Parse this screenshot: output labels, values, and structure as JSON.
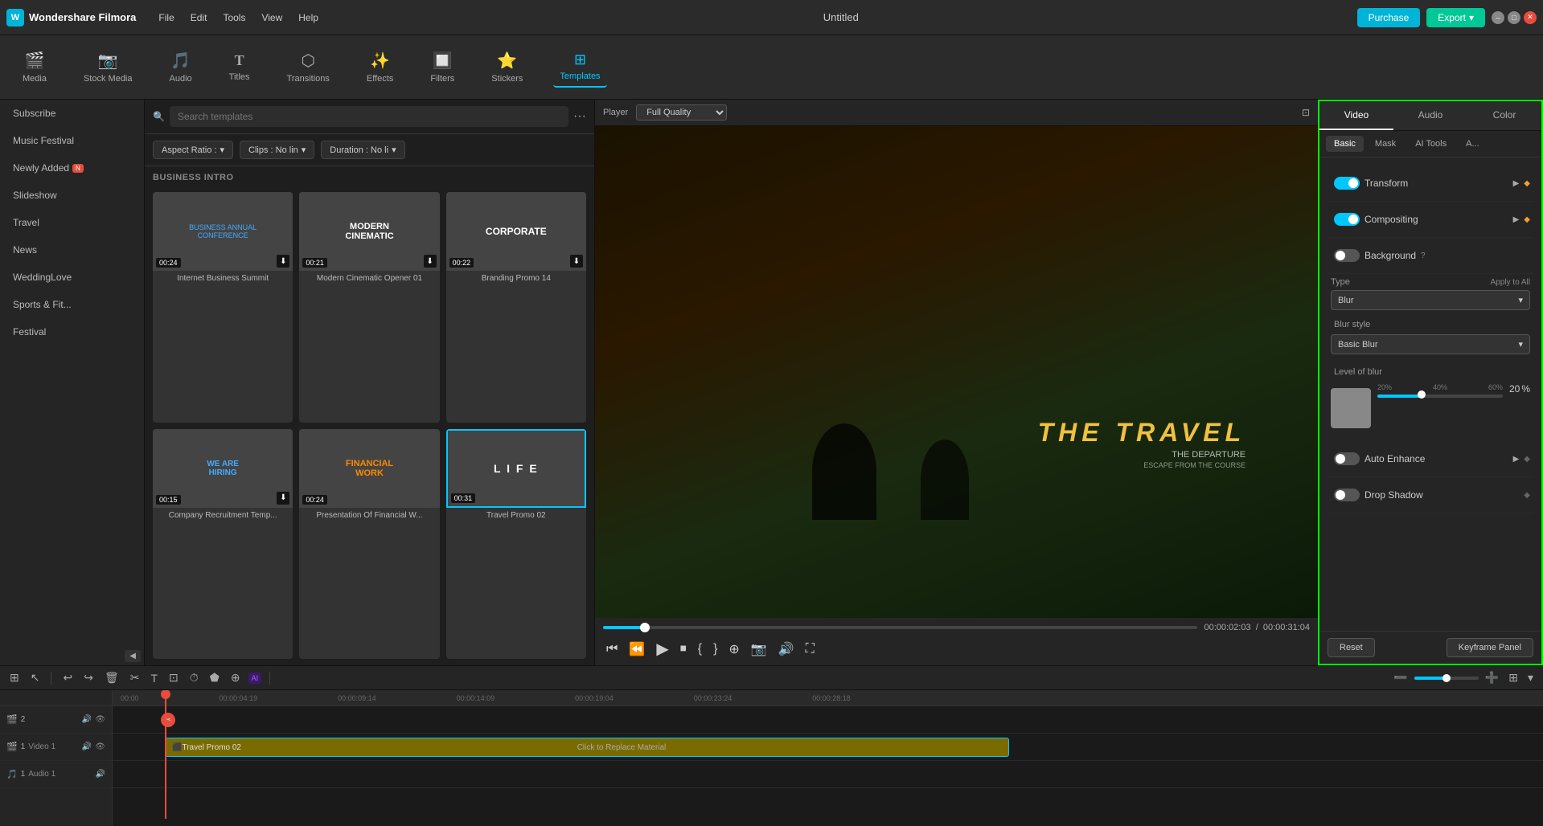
{
  "app": {
    "name": "Wondershare Filmora",
    "title": "Untitled"
  },
  "topbar": {
    "menu": [
      "File",
      "Edit",
      "Tools",
      "View",
      "Help"
    ],
    "purchase_label": "Purchase",
    "export_label": "Export"
  },
  "toolbar": {
    "items": [
      {
        "id": "media",
        "label": "Media",
        "icon": "🎬"
      },
      {
        "id": "stock",
        "label": "Stock Media",
        "icon": "📷"
      },
      {
        "id": "audio",
        "label": "Audio",
        "icon": "🎵"
      },
      {
        "id": "titles",
        "label": "Titles",
        "icon": "T"
      },
      {
        "id": "transitions",
        "label": "Transitions",
        "icon": "⬡"
      },
      {
        "id": "effects",
        "label": "Effects",
        "icon": "✨"
      },
      {
        "id": "filters",
        "label": "Filters",
        "icon": "🔲"
      },
      {
        "id": "stickers",
        "label": "Stickers",
        "icon": "⭐"
      },
      {
        "id": "templates",
        "label": "Templates",
        "icon": "⊞"
      }
    ]
  },
  "sidebar": {
    "items": [
      {
        "id": "subscribe",
        "label": "Subscribe"
      },
      {
        "id": "music-festival",
        "label": "Music Festival"
      },
      {
        "id": "newly-added",
        "label": "Newly Added",
        "badge": true
      },
      {
        "id": "slideshow",
        "label": "Slideshow"
      },
      {
        "id": "travel",
        "label": "Travel"
      },
      {
        "id": "news",
        "label": "News"
      },
      {
        "id": "weddinglove",
        "label": "WeddingLove"
      },
      {
        "id": "sports",
        "label": "Sports & Fit..."
      },
      {
        "id": "festival",
        "label": "Festival"
      }
    ]
  },
  "templates_panel": {
    "search_placeholder": "Search templates",
    "section_label": "BUSINESS INTRO",
    "filters": {
      "aspect_ratio": "Aspect Ratio :",
      "clips_no": "Clips : No lin",
      "duration": "Duration : No li"
    },
    "cards": [
      {
        "id": 1,
        "title": "Internet Business Summit",
        "duration": "00:24",
        "color": "business",
        "has_download": true
      },
      {
        "id": 2,
        "title": "Modern Cinematic Opener 01",
        "duration": "00:21",
        "color": "cinematic",
        "has_download": true
      },
      {
        "id": 3,
        "title": "Branding Promo 14",
        "duration": "00:22",
        "color": "corporate",
        "has_download": true
      },
      {
        "id": 4,
        "title": "Company Recruitment Temp...",
        "duration": "00:15",
        "color": "recruitment",
        "has_download": true
      },
      {
        "id": 5,
        "title": "Presentation Of Financial W...",
        "duration": "00:24",
        "color": "financial",
        "has_download": false
      },
      {
        "id": 6,
        "title": "Travel Promo 02",
        "duration": "00:31",
        "color": "travel",
        "has_download": false,
        "selected": true
      }
    ]
  },
  "player": {
    "label": "Player",
    "quality": "Full Quality",
    "current_time": "00:00:02:03",
    "total_time": "00:00:31:04",
    "video_title": "THE TRAVEL",
    "video_sub1": "THE DEPARTURE",
    "video_sub2": "ESCAPE FROM THE COURSE"
  },
  "right_panel": {
    "tabs": [
      "Video",
      "Audio",
      "Color"
    ],
    "subtabs": [
      "Basic",
      "Mask",
      "AI Tools",
      "A..."
    ],
    "transform_label": "Transform",
    "compositing_label": "Compositing",
    "background_label": "Background",
    "type_label": "Type",
    "apply_to_all": "Apply to All",
    "blur_label": "Blur",
    "blur_style_label": "Blur style",
    "blur_style_value": "Basic Blur",
    "level_of_blur_label": "Level of blur",
    "blur_level": "20",
    "blur_unit": "%",
    "level_markers": [
      "20%",
      "40%",
      "60%"
    ],
    "auto_enhance_label": "Auto Enhance",
    "drop_shadow_label": "Drop Shadow",
    "reset_label": "Reset",
    "keyframe_label": "Keyframe Panel"
  },
  "timeline": {
    "ruler_marks": [
      "00:00",
      "00:00:04:19",
      "00:00:09:14",
      "00:00:14:09",
      "00:00:19:04",
      "00:00:23:24",
      "00:00:28:18"
    ],
    "tracks": [
      {
        "id": "v2",
        "label": "2",
        "type": "video"
      },
      {
        "id": "v1",
        "label": "1",
        "type": "video",
        "name": "Video 1"
      },
      {
        "id": "a1",
        "label": "1",
        "type": "audio",
        "name": "Audio 1"
      }
    ],
    "clip": {
      "label": "Travel Promo 02",
      "center_text": "Click to Replace Material"
    }
  }
}
